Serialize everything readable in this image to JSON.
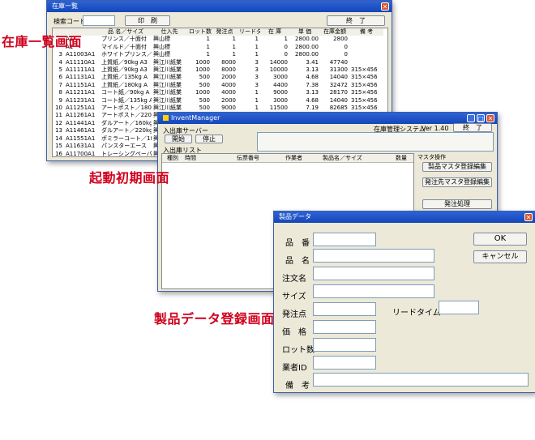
{
  "stock_window": {
    "title": "在庫一覧",
    "search_label": "検索コード",
    "print_button": "印　刷",
    "exit_button": "終　了",
    "columns": [
      "",
      "",
      "品 名／サイズ",
      "仕入先",
      "ロット数",
      "発注点",
      "リードタ",
      "在 庫",
      "単 価",
      "在庫金額",
      "備 考"
    ],
    "rows": [
      [
        "",
        "A1",
        "プリンス／十面付",
        "興山標",
        "1",
        "1",
        "1",
        "1",
        "2800.00",
        "2800",
        ""
      ],
      [
        "",
        "A1",
        "マイルド／十面付",
        "興山標",
        "1",
        "1",
        "1",
        "0",
        "2800.00",
        "0",
        ""
      ],
      [
        "3",
        "A11003A1",
        "ホワイトプリンス／",
        "興山標",
        "1",
        "1",
        "1",
        "0",
        "2800.00",
        "0",
        ""
      ],
      [
        "4",
        "A11110A1",
        "上質紙／90kg A3",
        "興江川紙業",
        "1000",
        "8000",
        "3",
        "14000",
        "3.41",
        "47740",
        ""
      ],
      [
        "5",
        "A11111A1",
        "上質紙／90kg A3",
        "興江川紙業",
        "1000",
        "8000",
        "3",
        "10000",
        "3.13",
        "31300",
        "315×456"
      ],
      [
        "6",
        "A11131A1",
        "上質紙／135kg A",
        "興江川紙業",
        "500",
        "2000",
        "3",
        "3000",
        "4.68",
        "14040",
        "315×456"
      ],
      [
        "7",
        "A11151A1",
        "上質紙／180kg A",
        "興江川紙業",
        "500",
        "4000",
        "3",
        "4400",
        "7.38",
        "32472",
        "315×456"
      ],
      [
        "8",
        "A11211A1",
        "コート紙／90kg A",
        "興江川紙業",
        "1000",
        "4000",
        "1",
        "9000",
        "3.13",
        "28170",
        "315×456"
      ],
      [
        "9",
        "A11231A1",
        "コート紙／135kg A",
        "興江川紙業",
        "500",
        "2000",
        "1",
        "3000",
        "4.68",
        "14040",
        "315×456"
      ],
      [
        "10",
        "A11251A1",
        "アートポスト／180k",
        "興江川紙業",
        "500",
        "9000",
        "1",
        "11500",
        "7.19",
        "82685",
        "315×456"
      ],
      [
        "11",
        "A11261A1",
        "アートポスト／220k",
        "興江川紙業",
        "500",
        "9000",
        "1",
        "10000",
        "8.80",
        "88000",
        "315×456"
      ],
      [
        "12",
        "A11441A1",
        "ダルアート／160kg",
        "興江川紙業",
        "500",
        "1500",
        "1",
        "0",
        "6.10",
        "0",
        "315×456"
      ],
      [
        "13",
        "A11461A1",
        "ダルアート／220kg",
        "興江川紙業",
        "500",
        "1500",
        "1",
        "0",
        "7.60",
        "0",
        "315×456"
      ],
      [
        "14",
        "A11551A1",
        "ポミラーコート／18",
        "興江川紙業",
        "",
        "",
        "",
        "",
        "",
        "",
        ""
      ],
      [
        "15",
        "A11631A1",
        "パンスターエース",
        "興江川紙業",
        "",
        "",
        "",
        "",
        "",
        "",
        ""
      ],
      [
        "16",
        "A11700A1",
        "トレーシングペーパ",
        "興江川紙業",
        "",
        "",
        "",
        "",
        "",
        "",
        ""
      ]
    ]
  },
  "main_window": {
    "title": "InventManager",
    "server_label": "入出庫サーバー",
    "start_button": "開始",
    "stop_button": "停止",
    "system_name": "在庫管理システム",
    "version": "Ver 1.40",
    "exit_button": "終　了",
    "list_label": "入出庫リスト",
    "columns": [
      "種別",
      "時間",
      "伝票番号",
      "作業者",
      "製品名／サイズ",
      "数量"
    ],
    "master_label": "マスタ操作",
    "product_master_button": "製品マスタ登録編集",
    "supplier_master_button": "発注先マスタ登録編集",
    "order_button": "発注処理"
  },
  "product_dialog": {
    "title": "製品データ",
    "ok_button": "OK",
    "cancel_button": "キャンセル",
    "fields": {
      "product_number": "品　番",
      "product_name": "品　名",
      "order_name": "注文名",
      "size": "サイズ",
      "order_point": "発注点",
      "lead_time": "リードタイム",
      "price": "価　格",
      "lot": "ロット数",
      "vendor_id": "業者ID",
      "remarks": "備　考"
    }
  },
  "captions": {
    "stock_list": "在庫一覧画面",
    "startup": "起動初期画面",
    "product_registration": "製品データ登録画面"
  }
}
